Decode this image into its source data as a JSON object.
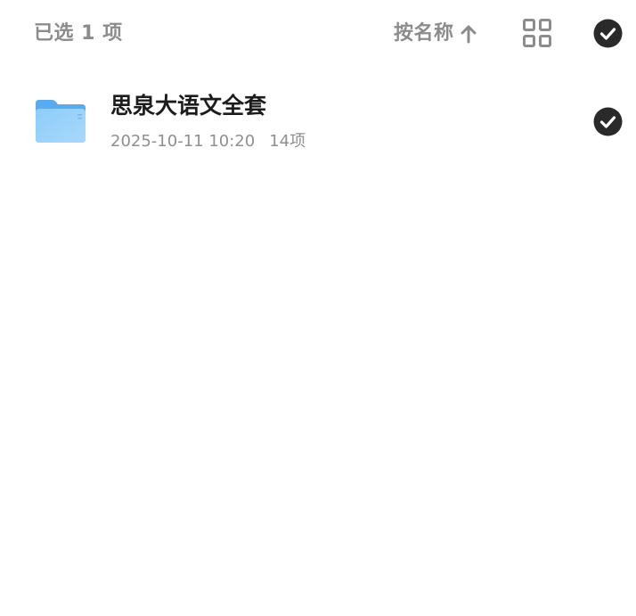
{
  "header": {
    "selected_label": "已选 1 项",
    "sort_label": "按名称",
    "sort_direction_icon": "arrow-up-icon",
    "view_toggle_icon": "grid-view-icon",
    "select_all_icon": "check-circle-icon"
  },
  "files": [
    {
      "icon": "folder-icon",
      "name": "思泉大语文全套",
      "date": "2025-10-11 10:20",
      "count": "14项",
      "selected": true
    }
  ],
  "colors": {
    "muted_text": "#8c8c8c",
    "title_text": "#1c1c1c",
    "check_fill": "#2a2a2a",
    "folder_blue": "#6ab7f5"
  }
}
